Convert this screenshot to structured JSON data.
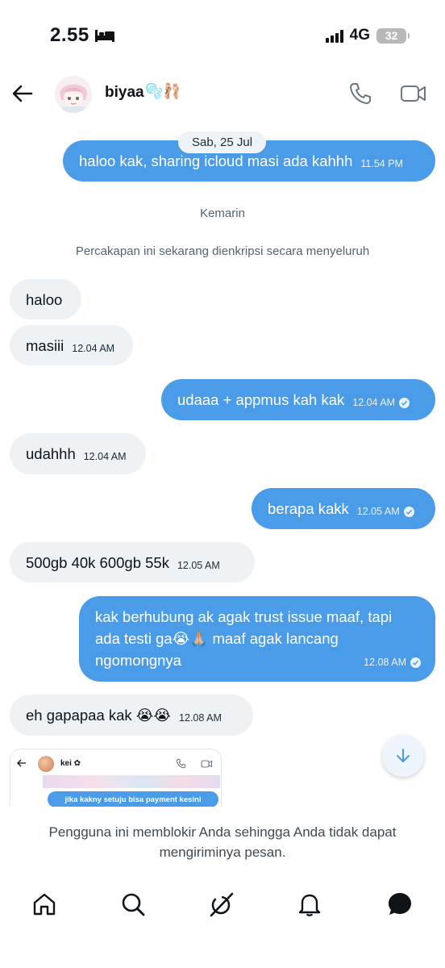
{
  "status_bar": {
    "time": "2.55",
    "network": "4G",
    "battery": "32"
  },
  "header": {
    "name": "biyaa",
    "name_emoji": "🫧🩰"
  },
  "date_chip": "Sab, 25 Jul",
  "section_label": "Kemarin",
  "encryption_notice": "Percakapan ini sekarang dienkripsi secara menyeluruh",
  "messages": [
    {
      "direction": "out",
      "text": "haloo kak, sharing icloud masi ada kahhh",
      "time": "11.54 PM",
      "read": false
    },
    {
      "direction": "in",
      "text": "haloo",
      "time": ""
    },
    {
      "direction": "in",
      "text": "masiii",
      "time": "12.04 AM"
    },
    {
      "direction": "out",
      "text": "udaaa + appmus kah kak",
      "time": "12.04 AM",
      "read": true
    },
    {
      "direction": "in",
      "text": "udahhh",
      "time": "12.04 AM"
    },
    {
      "direction": "out",
      "text": "berapa kakk",
      "time": "12.05 AM",
      "read": true
    },
    {
      "direction": "in",
      "text": "500gb 40k 600gb 55k",
      "time": "12.05 AM"
    },
    {
      "direction": "out",
      "text": "kak berhubung ak agak trust issue maaf, tapi ada testi ga😭🙏🏼 maaf agak lancang ngomongnya",
      "time": "12.08 AM",
      "read": true
    },
    {
      "direction": "in",
      "text": "eh gapapaa kak 😭😭",
      "time": "12.08 AM"
    }
  ],
  "preview": {
    "name": "kei ✿",
    "bubble_text": "jika kakny setuju bisa payment kesini"
  },
  "block_notice": "Pengguna ini memblokir Anda sehingga Anda tidak dapat mengiriminya pesan.",
  "nav": [
    "home",
    "search",
    "grok",
    "notifications",
    "messages"
  ],
  "colors": {
    "outgoing_bubble": "#4a9be8",
    "incoming_bubble": "#eff2f5",
    "muted_text": "#536471"
  }
}
